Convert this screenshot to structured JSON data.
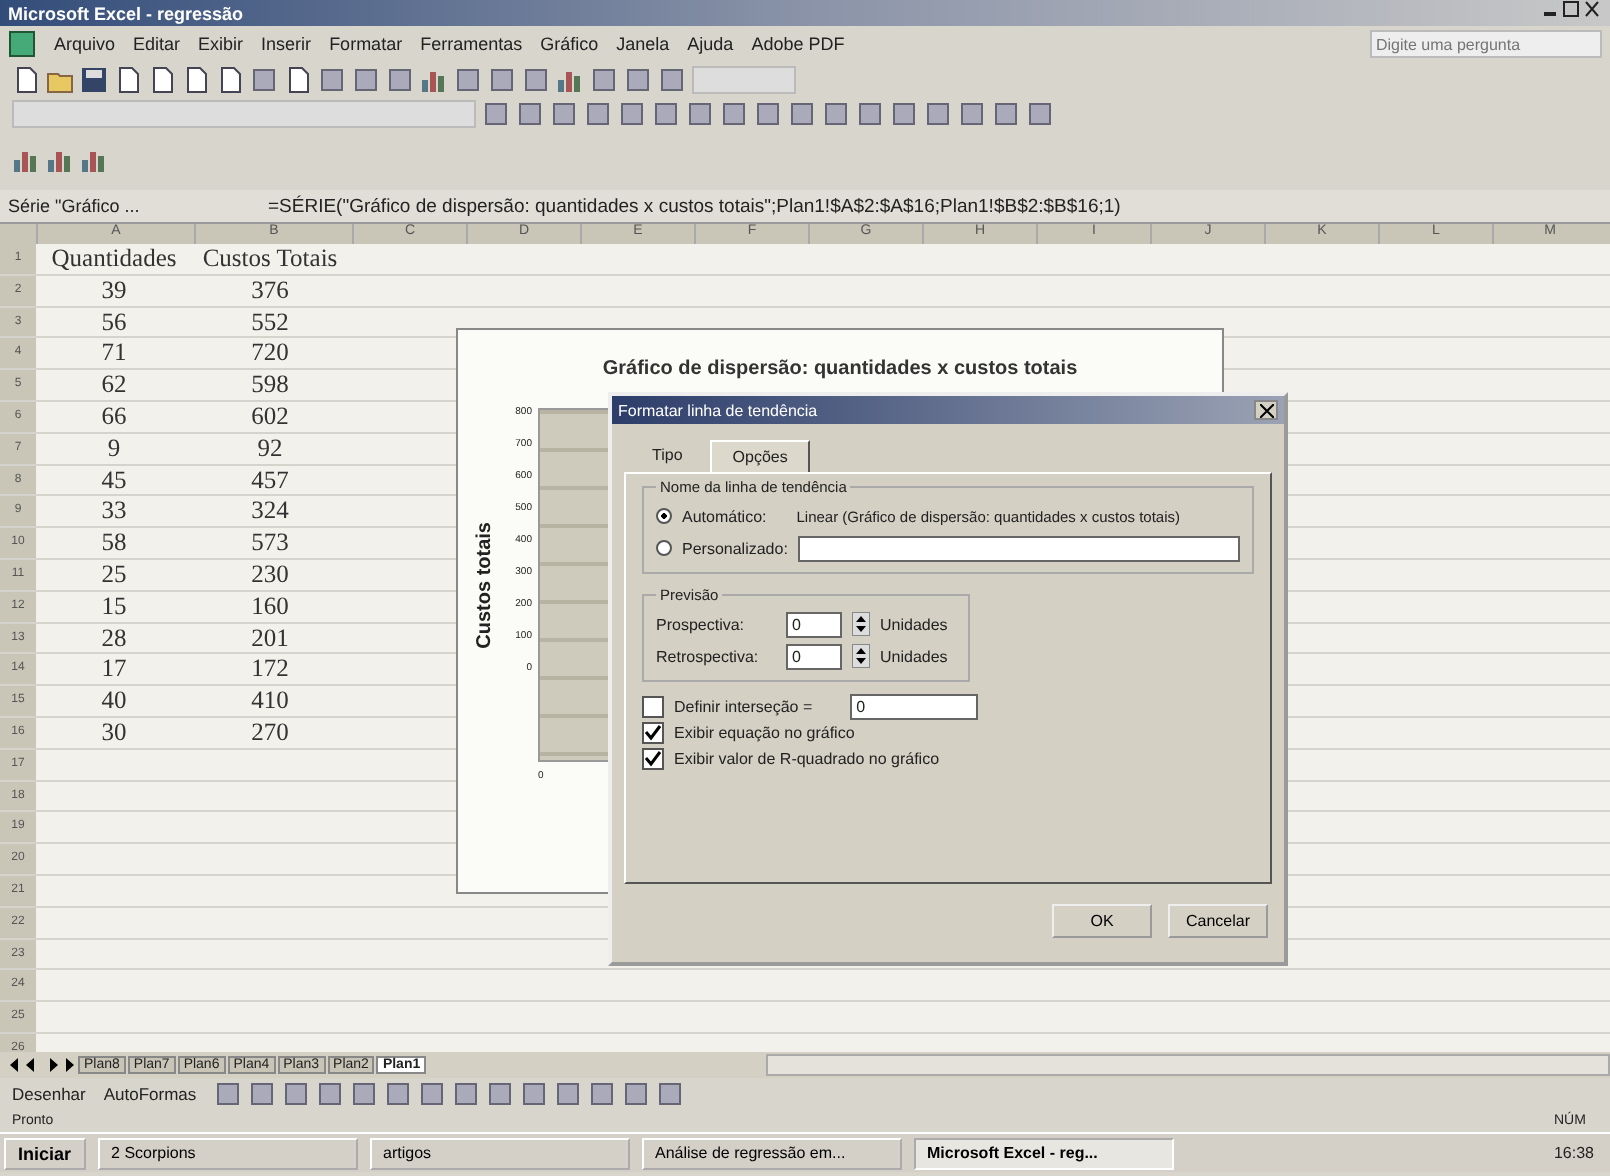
{
  "window": {
    "title": "Microsoft Excel - regressão"
  },
  "menu": [
    "Arquivo",
    "Editar",
    "Exibir",
    "Inserir",
    "Formatar",
    "Ferramentas",
    "Gráfico",
    "Janela",
    "Ajuda",
    "Adobe PDF"
  ],
  "help_search": {
    "placeholder": "Digite uma pergunta"
  },
  "formula_bar": {
    "name_box": "Série \"Gráfico ...",
    "formula": "=SÉRIE(\"Gráfico de dispersão: quantidades x custos totais\";Plan1!$A$2:$A$16;Plan1!$B$2:$B$16;1)"
  },
  "columns": [
    "A",
    "B",
    "C",
    "D",
    "E",
    "F",
    "G",
    "H",
    "I",
    "J",
    "K",
    "L",
    "M"
  ],
  "row_numbers": [
    "1",
    "2",
    "3",
    "4",
    "5",
    "6",
    "7",
    "8",
    "9",
    "10",
    "11",
    "12",
    "13",
    "14",
    "15",
    "16",
    "17",
    "18",
    "19",
    "20",
    "21",
    "22",
    "23",
    "24",
    "25",
    "26"
  ],
  "table": {
    "header": [
      "Quantidades",
      "Custos Totais"
    ],
    "rows": [
      [
        "39",
        "376"
      ],
      [
        "56",
        "552"
      ],
      [
        "71",
        "720"
      ],
      [
        "62",
        "598"
      ],
      [
        "66",
        "602"
      ],
      [
        "9",
        "92"
      ],
      [
        "45",
        "457"
      ],
      [
        "33",
        "324"
      ],
      [
        "58",
        "573"
      ],
      [
        "25",
        "230"
      ],
      [
        "15",
        "160"
      ],
      [
        "28",
        "201"
      ],
      [
        "17",
        "172"
      ],
      [
        "40",
        "410"
      ],
      [
        "30",
        "270"
      ]
    ]
  },
  "chart": {
    "title": "Gráfico de dispersão: quantidades x custos totais",
    "ylabel": "Custos totais",
    "yticks": [
      "800",
      "700",
      "600",
      "500",
      "400",
      "300",
      "200",
      "100",
      "0"
    ],
    "xtick": "0"
  },
  "dialog": {
    "title": "Formatar linha de tendência",
    "tabs": [
      {
        "label": "Tipo",
        "selected": false
      },
      {
        "label": "Opções",
        "selected": true
      }
    ],
    "name_group": "Nome da linha de tendência",
    "name_options": [
      {
        "label": "Automático:",
        "selected": true,
        "value": "Linear (Gráfico de dispersão: quantidades x custos totais)"
      },
      {
        "label": "Personalizado:",
        "selected": false
      }
    ],
    "forecast_group": "Previsão",
    "forecast": [
      {
        "label": "Prospectiva:",
        "value": "0",
        "unit": "Unidades"
      },
      {
        "label": "Retrospectiva:",
        "value": "0",
        "unit": "Unidades"
      }
    ],
    "options": [
      {
        "label": "Definir interseção =",
        "checked": false,
        "value": "0"
      },
      {
        "label": "Exibir equação no gráfico",
        "checked": true
      },
      {
        "label": "Exibir valor de R-quadrado no gráfico",
        "checked": true
      }
    ],
    "buttons": [
      "OK",
      "Cancelar"
    ]
  },
  "sheet_tabs": [
    {
      "label": "Plan8",
      "selected": false
    },
    {
      "label": "Plan7",
      "selected": false
    },
    {
      "label": "Plan6",
      "selected": false
    },
    {
      "label": "Plan4",
      "selected": false
    },
    {
      "label": "Plan3",
      "selected": false
    },
    {
      "label": "Plan2",
      "selected": false
    },
    {
      "label": "Plan1",
      "selected": true
    }
  ],
  "drawing_toolbar": [
    "Desenhar",
    "AutoFormas"
  ],
  "status_bar": {
    "left": "Pronto",
    "right": "NÚM"
  },
  "taskbar": {
    "start": "Iniciar",
    "items": [
      {
        "label": "2 Scorpions",
        "selected": false
      },
      {
        "label": "artigos",
        "selected": false
      },
      {
        "label": "Análise de regressão em...",
        "selected": false
      },
      {
        "label": "Microsoft Excel - reg...",
        "selected": true
      }
    ],
    "clock": "16:38"
  }
}
